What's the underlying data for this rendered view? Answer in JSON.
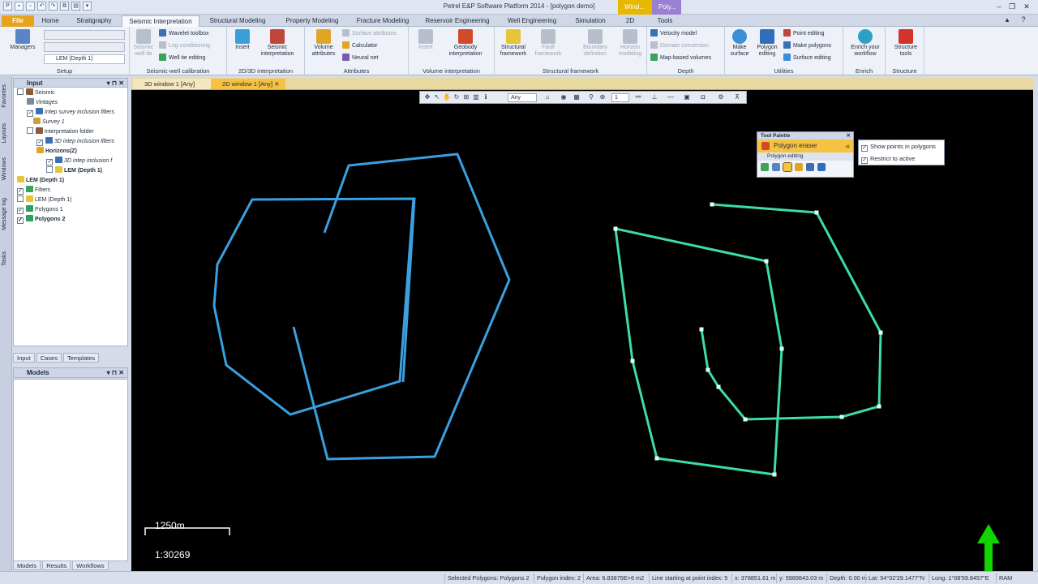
{
  "app": {
    "title": "Petrel E&P Software Platform 2014 - [polygon demo]",
    "context_tabs": [
      "Wind...",
      "Poly..."
    ]
  },
  "ribbon_tabs": [
    "File",
    "Home",
    "Stratigraphy",
    "Seismic Interpretation",
    "Structural Modeling",
    "Property Modeling",
    "Fracture Modeling",
    "Reservoir Engineering",
    "Well Engineering",
    "Simulation",
    "2D",
    "Tools"
  ],
  "ribbon": {
    "setup": {
      "label": "Setup",
      "managers": "Managers",
      "dropdown": "LEM (Depth 1)"
    },
    "calibration": {
      "label": "Seismic-well calibration",
      "seismic_well_tie": "Seismic well tie",
      "wavelet_toolbox": "Wavelet toolbox",
      "log_conditioning": "Log conditioning",
      "well_tie_editing": "Well tie editing"
    },
    "interp2d3d": {
      "label": "2D/3D interpretation",
      "insert": "Insert",
      "seismic_interpretation": "Seismic interpretation"
    },
    "attributes": {
      "label": "Attributes",
      "volume_attributes": "Volume attributes",
      "surface_attributes": "Surface attributes",
      "calculator": "Calculator",
      "neural_net": "Neural net"
    },
    "volume_interp": {
      "label": "Volume interpretation",
      "insert": "Insert",
      "geobody": "Geobody interpretation"
    },
    "structural": {
      "label": "Structural framework",
      "structural_framework": "Structural framework",
      "fault_framework": "Fault framework",
      "boundary_definition": "Boundary definition",
      "horizon_modeling": "Horizon modeling"
    },
    "depth": {
      "label": "Depth",
      "velocity_model": "Velocity model",
      "domain_conversion": "Domain conversion",
      "map_based_volumes": "Map-based volumes"
    },
    "utilities": {
      "label": "Utilities",
      "make_surface": "Make surface",
      "polygon_editing": "Polygon editing",
      "point_editing": "Point editing",
      "make_polygons": "Make polygons",
      "surface_editing": "Surface editing"
    },
    "enrich": {
      "label": "Enrich",
      "enrich_workflow": "Enrich your workflow"
    },
    "structure": {
      "label": "Structure",
      "structure_tools": "Structure tools"
    }
  },
  "sidebar_tabs": [
    "Favorites",
    "Layouts",
    "Windows",
    "Message log",
    "Tasks"
  ],
  "input_panel": {
    "title": "Input",
    "tree": [
      {
        "label": "Seismic",
        "checked": false,
        "bold": false,
        "italic": false,
        "color": "#8c5a3c"
      },
      {
        "label": "Vintages",
        "checked": null,
        "bold": false,
        "italic": true,
        "color": "#7a8a9c"
      },
      {
        "label": "Intep survey inclusion filters",
        "checked": true,
        "bold": false,
        "italic": true,
        "color": "#3d6fb3"
      },
      {
        "label": "Survey 1",
        "checked": null,
        "bold": false,
        "italic": true,
        "color": "#c9a33a"
      },
      {
        "label": "Interpretation folder",
        "checked": false,
        "bold": false,
        "italic": false,
        "color": "#8c5a3c"
      },
      {
        "label": "3D intep inclusion filters",
        "checked": true,
        "bold": false,
        "italic": true,
        "color": "#3d6fb3"
      },
      {
        "label": "Horizons(Z)",
        "checked": null,
        "bold": true,
        "italic": false,
        "color": "#e0a526"
      },
      {
        "label": "3D intep inclusion f",
        "checked": true,
        "bold": false,
        "italic": true,
        "color": "#3d6fb3"
      },
      {
        "label": "LEM (Depth 1)",
        "checked": false,
        "bold": true,
        "italic": false,
        "color": "#e8c43a"
      },
      {
        "label": "LEM (Depth 1)",
        "checked": null,
        "bold": true,
        "italic": false,
        "color": "#e8c43a"
      },
      {
        "label": "Filters",
        "checked": true,
        "bold": false,
        "italic": false,
        "color": "#3da35a"
      },
      {
        "label": "LEM (Depth 1)",
        "checked": false,
        "bold": false,
        "italic": false,
        "color": "#e8c43a"
      },
      {
        "label": "Polygons 1",
        "checked": true,
        "bold": false,
        "italic": false,
        "color": "#2f9e5a"
      },
      {
        "label": "Polygons 2",
        "checked": true,
        "bold": true,
        "italic": false,
        "color": "#2f9e5a"
      }
    ],
    "bottom_tabs": [
      "Input",
      "Cases",
      "Templates"
    ]
  },
  "models_panel": {
    "title": "Models",
    "bottom_tabs": [
      "Models",
      "Results",
      "Workflows"
    ]
  },
  "doc_tabs": [
    "3D window 1 [Any]",
    "2D window 1 [Any]"
  ],
  "view_toolbar": {
    "domain": "Any",
    "zoom": "1"
  },
  "tool_palette": {
    "title": "Tool Palette",
    "active_tool": "Polygon eraser",
    "section": "Polygon editing",
    "options": [
      {
        "label": "Show points in polygons",
        "checked": true
      },
      {
        "label": "Restrict to active",
        "checked": true
      }
    ]
  },
  "map": {
    "scale_bar": "1250m",
    "scale_ratio": "1:30269",
    "colors": {
      "polygon1": "#3aa0e0",
      "polygon2": "#3ddca8",
      "north": "#11d400"
    }
  },
  "status": {
    "selected": "Selected Polygons: Polygons 2",
    "polygon_index": "Polygon index: 2",
    "area": "Area: 6.83875E+6 m2",
    "line": "Line starting at point index: 5",
    "x": "x: 378851.61 m",
    "y": "y: 5989843.03 m",
    "depth": "Depth: 0.00 m",
    "lat": "Lat: 54°02'29.1477\"N",
    "long": "Long: 1°08'59.8457\"E",
    "ram": "RAM"
  }
}
